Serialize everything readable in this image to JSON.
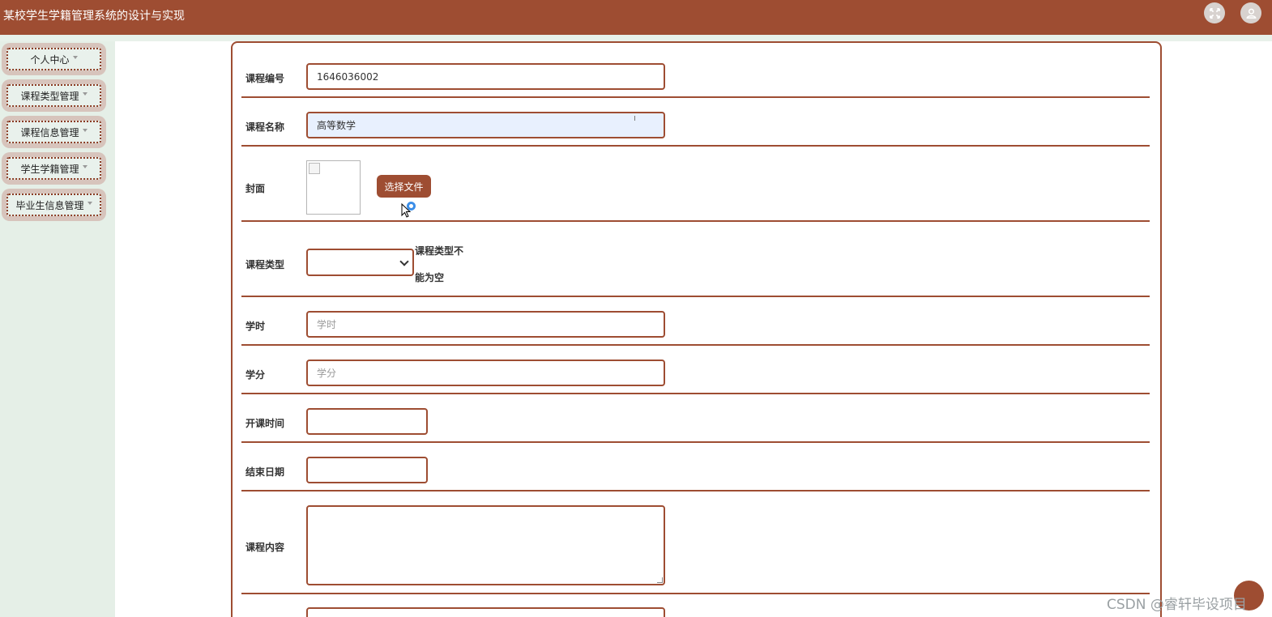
{
  "header": {
    "title": "某校学生学籍管理系统的设计与实现",
    "icons": [
      "fullscreen-icon",
      "user-icon"
    ]
  },
  "sidebar": {
    "items": [
      {
        "label": "个人中心"
      },
      {
        "label": "课程类型管理"
      },
      {
        "label": "课程信息管理"
      },
      {
        "label": "学生学籍管理"
      },
      {
        "label": "毕业生信息管理"
      }
    ]
  },
  "form": {
    "course_code": {
      "label": "课程编号",
      "value": "1646036002"
    },
    "course_name": {
      "label": "课程名称",
      "value": "高等数学"
    },
    "cover": {
      "label": "封面",
      "button": "选择文件"
    },
    "course_type": {
      "label": "课程类型",
      "value": "",
      "error_line1": "课程类型不",
      "error_line2": "能为空"
    },
    "hours": {
      "label": "学时",
      "placeholder": "学时"
    },
    "credits": {
      "label": "学分",
      "placeholder": "学分"
    },
    "start_time": {
      "label": "开课时间",
      "value": ""
    },
    "end_date": {
      "label": "结束日期",
      "value": ""
    },
    "content": {
      "label": "课程内容",
      "value": ""
    }
  },
  "watermark": "CSDN @睿轩毕设项目",
  "colors": {
    "primary": "#9e4d32",
    "sidebar_bg": "#e5efe7",
    "menu_bg": "#d7c4bc"
  }
}
